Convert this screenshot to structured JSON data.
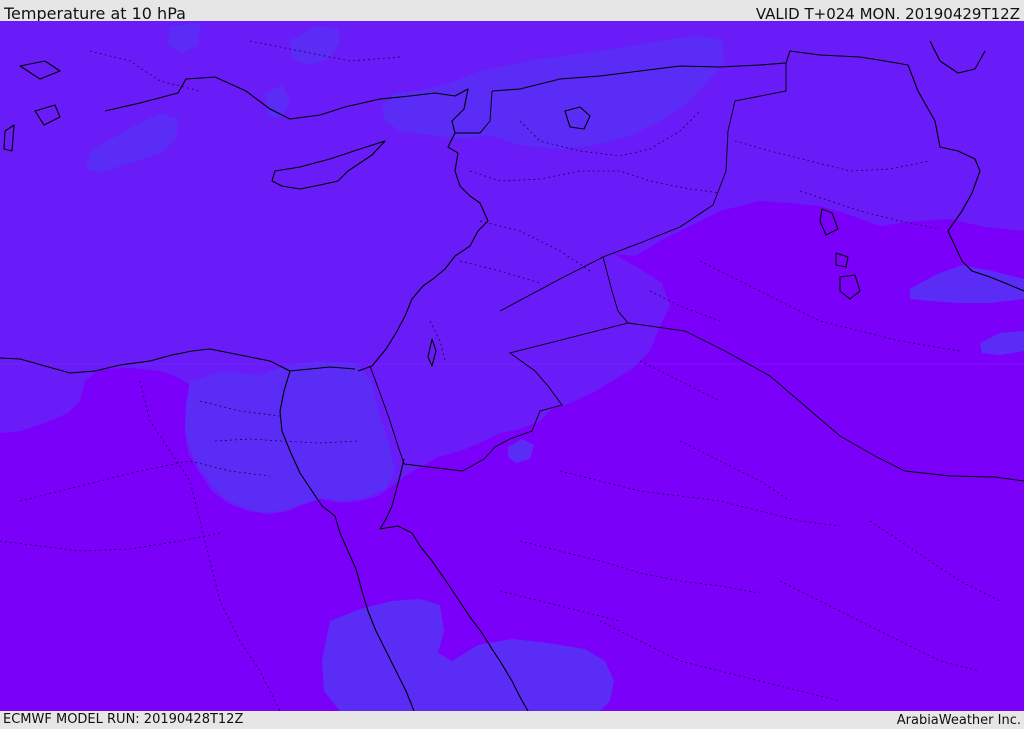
{
  "header": {
    "title": "Temperature at 10 hPa",
    "valid": "VALID T+024 MON. 20190429T12Z"
  },
  "footer": {
    "model_run": "ECMWF MODEL RUN: 20190428T12Z",
    "credit": "ArabiaWeather Inc."
  },
  "colors": {
    "chrome_background": "#e6e6e6",
    "cold_band": "#6a1cf8",
    "warm_band": "#7a00fa",
    "coolest_patches": "#5a2cf6",
    "coastlines": "#000000"
  }
}
